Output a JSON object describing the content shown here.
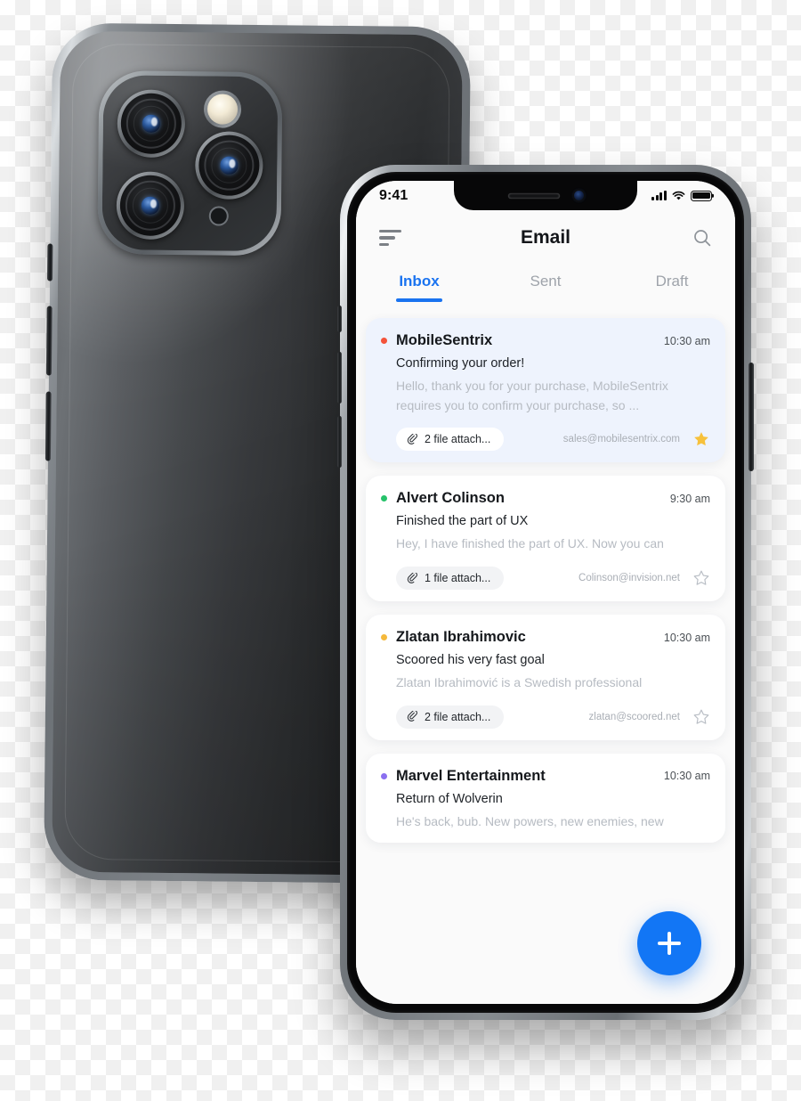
{
  "status_bar": {
    "time": "9:41",
    "signal_icon": "cellular-signal-icon",
    "wifi_icon": "wifi-icon",
    "battery_icon": "battery-full-icon"
  },
  "header": {
    "title": "Email",
    "menu_icon": "hamburger-menu-icon",
    "search_icon": "search-icon"
  },
  "tabs": [
    {
      "label": "Inbox",
      "active": true
    },
    {
      "label": "Sent",
      "active": false
    },
    {
      "label": "Draft",
      "active": false
    }
  ],
  "colors": {
    "accent": "#1a73f0",
    "fab": "#1276f5",
    "unread_card_bg": "#eef3fd",
    "card_bg": "#ffffff",
    "screen_bg": "#fafafa",
    "star_filled": "#f7c13b",
    "star_empty": "#b9bec5",
    "dot_red": "#f4533a",
    "dot_green": "#26c26a",
    "dot_yellow": "#f5b93c",
    "dot_purple": "#8a6ff0"
  },
  "emails": [
    {
      "sender": "MobileSentrix",
      "time": "10:30 am",
      "subject": "Confirming your order!",
      "preview": "Hello, thank you for your purchase, MobileSentrix requires you to confirm your purchase, so ...",
      "attachment": "2 file attach...",
      "address": "sales@mobilesentrix.com",
      "starred": true,
      "unread": true,
      "dot_color": "#f4533a"
    },
    {
      "sender": "Alvert Colinson",
      "time": "9:30 am",
      "subject": "Finished the part of UX",
      "preview": "Hey, I have finished the part of UX. Now you can",
      "attachment": "1 file attach...",
      "address": "Colinson@invision.net",
      "starred": false,
      "unread": false,
      "dot_color": "#26c26a"
    },
    {
      "sender": "Zlatan Ibrahimovic",
      "time": "10:30 am",
      "subject": "Scoored his very fast goal",
      "preview": "Zlatan Ibrahimović is a Swedish professional",
      "attachment": "2 file attach...",
      "address": "zlatan@scoored.net",
      "starred": false,
      "unread": false,
      "dot_color": "#f5b93c"
    },
    {
      "sender": "Marvel Entertainment",
      "time": "10:30 am",
      "subject": "Return of Wolverin",
      "preview": "He's back, bub. New powers, new enemies, new",
      "attachment": "",
      "address": "",
      "starred": false,
      "unread": false,
      "dot_color": "#8a6ff0"
    }
  ],
  "fab": {
    "icon": "plus-icon",
    "label": "+"
  },
  "back_phone": {
    "lenses": [
      "camera-lens-top-left",
      "camera-lens-bottom-left",
      "camera-lens-middle-right"
    ],
    "flash_icon": "camera-flash-icon",
    "mic_icon": "microphone-hole-icon"
  }
}
